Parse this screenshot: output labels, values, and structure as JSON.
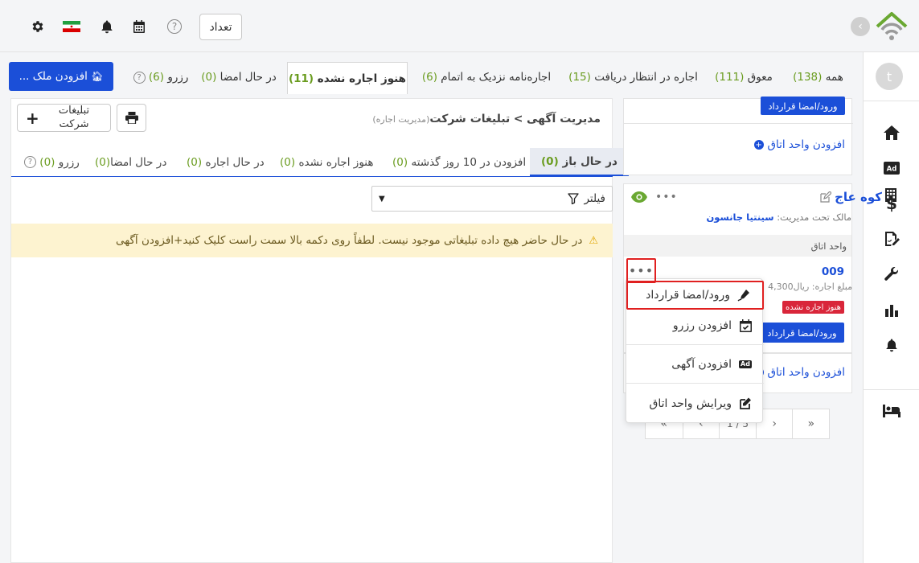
{
  "topbar": {
    "count_label": "تعداد",
    "icons": [
      "gear-icon",
      "iran-flag-icon",
      "bell-icon",
      "calendar-icon",
      "help-icon"
    ]
  },
  "sidebar": {
    "avatar_letter": "t",
    "icons": [
      "home-icon",
      "ad-icon",
      "dollar-icon",
      "contract-icon",
      "wrench-icon",
      "chart-icon",
      "bell-icon",
      "bed-icon"
    ]
  },
  "status_tabs": [
    {
      "label": "همه",
      "count": "(138)"
    },
    {
      "label": "معوق",
      "count": "(111)"
    },
    {
      "label": "اجاره در انتظار دریافت",
      "count": "(15)"
    },
    {
      "label": "اجاره‌نامه نزدیک به اتمام",
      "count": "(6)"
    },
    {
      "label": "هنوز اجاره نشده",
      "count": "(11)"
    },
    {
      "label": "در حال امضا",
      "count": "(0)"
    },
    {
      "label": "رزرو",
      "count": "(6)"
    }
  ],
  "add_property_label": "افزودن ملک ...",
  "ads_panel": {
    "breadcrumb_root": "مدیریت آگهی",
    "breadcrumb_sep": ">",
    "breadcrumb_current": "تبلیغات شرکت",
    "breadcrumb_sub": "(مدیریت اجاره)",
    "company_ads_label": "تبلیغات شرکت",
    "tabs": [
      {
        "label": "در حال باز",
        "count": "(0)"
      },
      {
        "label": "افزودن در 10 روز گذشته",
        "count": "(0)"
      },
      {
        "label": "هنوز اجاره نشده",
        "count": "(0)"
      },
      {
        "label": "در حال اجاره",
        "count": "(0)"
      },
      {
        "label": "در حال امضا",
        "count": "(0)"
      },
      {
        "label": "رزرو",
        "count": "(0)"
      }
    ],
    "filter_label": "فیلتر",
    "empty_message": "در حال حاضر هیچ داده تبلیغاتی موجود نیست. لطفاً روی دکمه بالا سمت راست کلیک کنید+افزودن آگهی"
  },
  "property": {
    "top_sign_button": "ورود/امضا قرارداد",
    "top_add_unit": "افزودن واحد اتاق",
    "name": "کوه عاج",
    "owner_label": "مالک تحت مدیریت:",
    "owner_name": "سینتیا جانسون",
    "units_header": "واحد اتاق",
    "unit_number": "009",
    "rent_label": "مبلغ اجاره: ریال",
    "rent_value": "4,300",
    "status_badge": "هنوز اجاره نشده",
    "sign_button": "ورود/امضا قرارداد",
    "add_unit": "افزودن واحد اتاق",
    "colors": {
      "accent": "#1b4fd8",
      "danger": "#d9263a",
      "count": "#6a9c1f"
    }
  },
  "pager": {
    "page_info": "1 / 5"
  },
  "dropdown": {
    "items": [
      {
        "label": "ورود/امضا قرارداد",
        "icon": "pen-icon"
      },
      {
        "label": "افزودن رزرو",
        "icon": "calendar-check-icon"
      },
      {
        "label": "افزودن آگهی",
        "icon": "ad-icon"
      },
      {
        "label": "ویرایش واحد اتاق",
        "icon": "edit-icon"
      }
    ]
  }
}
